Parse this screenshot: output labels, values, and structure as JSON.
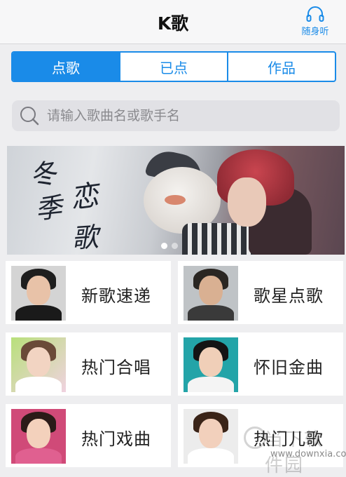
{
  "header": {
    "title": "K歌",
    "listen_label": "随身听",
    "listen_icon": "headphones-icon"
  },
  "tabs": [
    {
      "label": "点歌",
      "active": true
    },
    {
      "label": "已点",
      "active": false
    },
    {
      "label": "作品",
      "active": false
    }
  ],
  "search": {
    "placeholder": "请输入歌曲名或歌手名",
    "icon": "search-icon"
  },
  "banner": {
    "text": [
      "冬",
      "季",
      "恋",
      "歌"
    ],
    "slide_count": 2,
    "active_slide": 1
  },
  "categories": [
    {
      "label": "新歌速递"
    },
    {
      "label": "歌星点歌"
    },
    {
      "label": "热门合唱"
    },
    {
      "label": "怀旧金曲"
    },
    {
      "label": "热门戏曲"
    },
    {
      "label": "热门儿歌"
    }
  ],
  "watermark": {
    "text": "当下软件园",
    "url": "www.downxia.com"
  },
  "colors": {
    "accent": "#1a8be8",
    "background": "#eeeef0"
  }
}
